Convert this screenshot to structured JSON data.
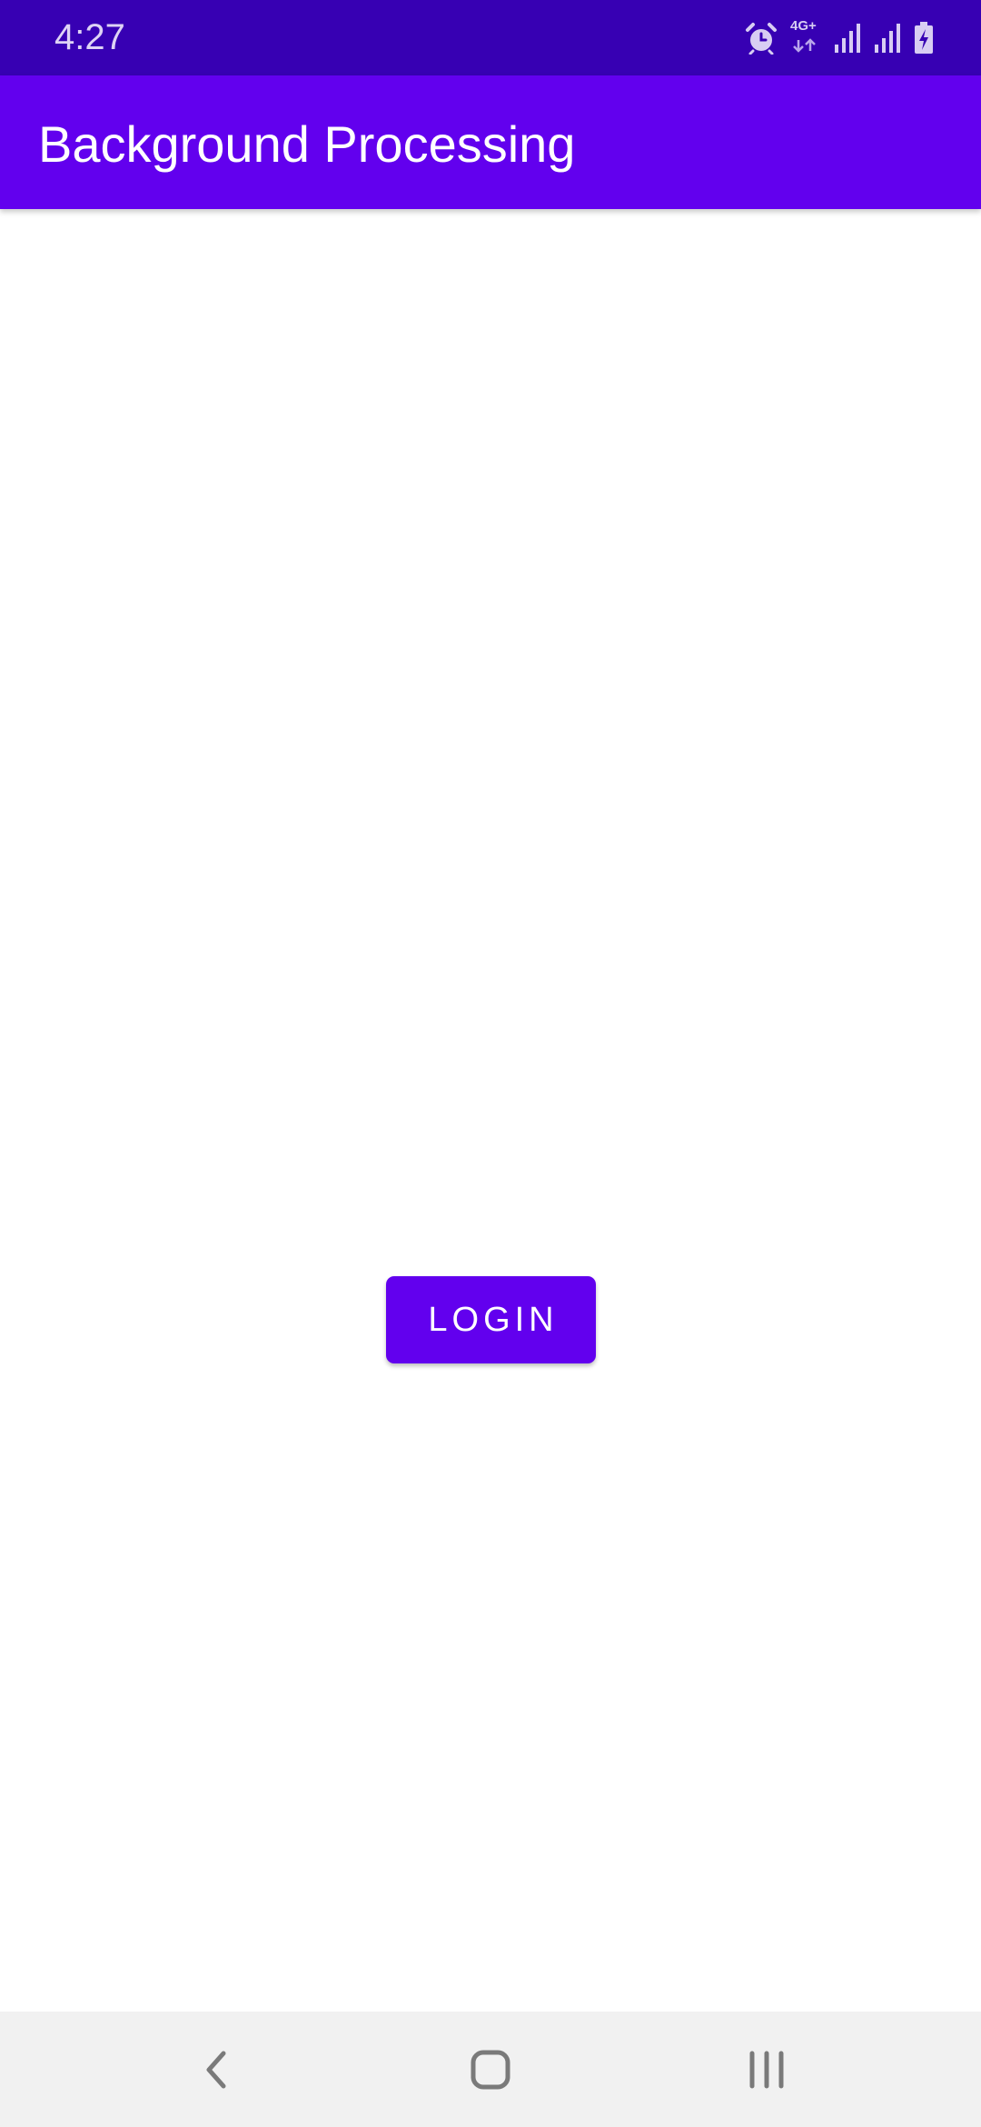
{
  "status_bar": {
    "time": "4:27",
    "network_label": "4G+",
    "icons": [
      "alarm-icon",
      "network-activity-icon",
      "signal-icon",
      "signal-icon",
      "battery-charging-icon"
    ]
  },
  "app_bar": {
    "title": "Background Processing"
  },
  "main": {
    "login_button_label": "LOGIN"
  },
  "nav_bar": {
    "icons": [
      "back-icon",
      "home-icon",
      "recents-icon"
    ]
  },
  "colors": {
    "status_bar": "#3700b3",
    "primary": "#6200ee",
    "background": "#ffffff",
    "nav_bar": "#f1f1f1"
  }
}
